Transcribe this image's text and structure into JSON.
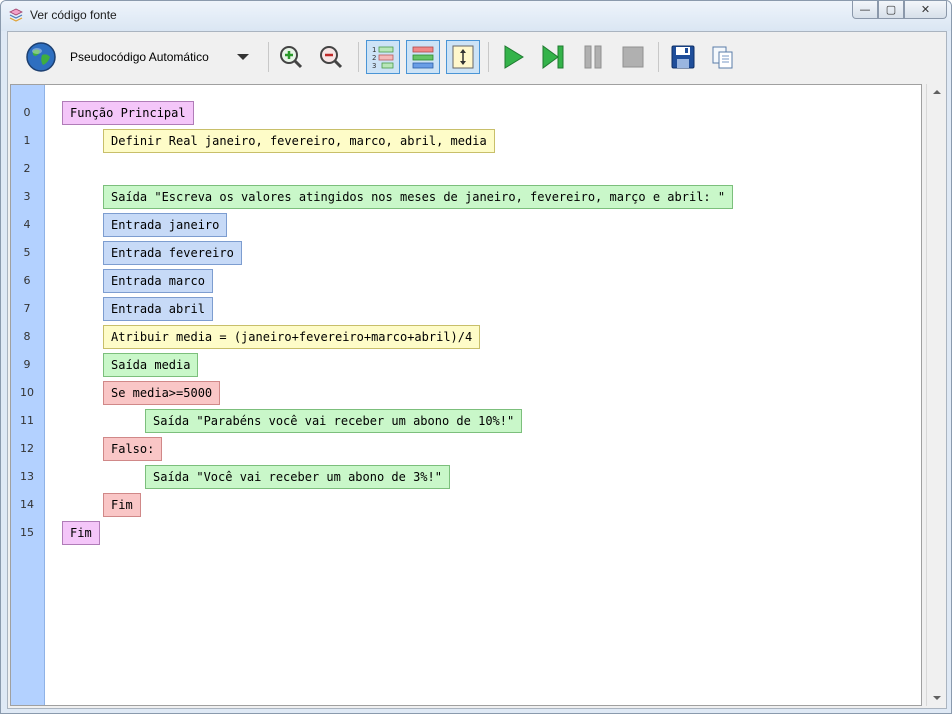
{
  "window": {
    "title": "Ver código fonte",
    "minimize_glyph": "—",
    "maximize_glyph": "▢",
    "close_glyph": "✕"
  },
  "toolbar": {
    "language_label": "Pseudocódigo Automático",
    "icons": [
      "globe-icon",
      "chevron-down-icon",
      "zoom-in-icon",
      "zoom-out-icon",
      "line-numbers-icon",
      "color-blocks-icon",
      "fit-height-icon",
      "run-icon",
      "step-icon",
      "pause-icon",
      "stop-icon",
      "save-icon",
      "copy-icon"
    ]
  },
  "code": {
    "line_numbers": [
      "0",
      "1",
      "2",
      "3",
      "4",
      "5",
      "6",
      "7",
      "8",
      "9",
      "10",
      "11",
      "12",
      "13",
      "14",
      "15"
    ],
    "lines": [
      {
        "text": "Função Principal",
        "kind": "func",
        "indent": 0
      },
      {
        "text": "Definir Real janeiro, fevereiro, marco, abril, media",
        "kind": "decl",
        "indent": 1
      },
      {
        "text": "",
        "kind": "empty",
        "indent": 1
      },
      {
        "text": "Saída \"Escreva os valores atingidos nos meses de janeiro, fevereiro, março e abril: \"",
        "kind": "out",
        "indent": 1
      },
      {
        "text": "Entrada janeiro",
        "kind": "in",
        "indent": 1
      },
      {
        "text": "Entrada fevereiro",
        "kind": "in",
        "indent": 1
      },
      {
        "text": "Entrada marco",
        "kind": "in",
        "indent": 1
      },
      {
        "text": "Entrada abril",
        "kind": "in",
        "indent": 1
      },
      {
        "text": "Atribuir media = (janeiro+fevereiro+marco+abril)/4",
        "kind": "decl",
        "indent": 1
      },
      {
        "text": "Saída media",
        "kind": "out",
        "indent": 1
      },
      {
        "text": "Se media>=5000",
        "kind": "cond",
        "indent": 1
      },
      {
        "text": "Saída \"Parabéns você vai receber um abono de 10%!\"",
        "kind": "out",
        "indent": 2
      },
      {
        "text": "Falso:",
        "kind": "cond",
        "indent": 1
      },
      {
        "text": "Saída \"Você vai receber um abono de 3%!\"",
        "kind": "out",
        "indent": 2
      },
      {
        "text": "Fim",
        "kind": "cond",
        "indent": 1
      },
      {
        "text": "Fim",
        "kind": "func",
        "indent": 0
      }
    ]
  },
  "colors": {
    "func": "#f4c6f9",
    "decl": "#fefcc8",
    "out": "#c9f7c9",
    "in": "#c7daf7",
    "cond": "#f9c6c6",
    "gutter": "#b3d1ff"
  }
}
